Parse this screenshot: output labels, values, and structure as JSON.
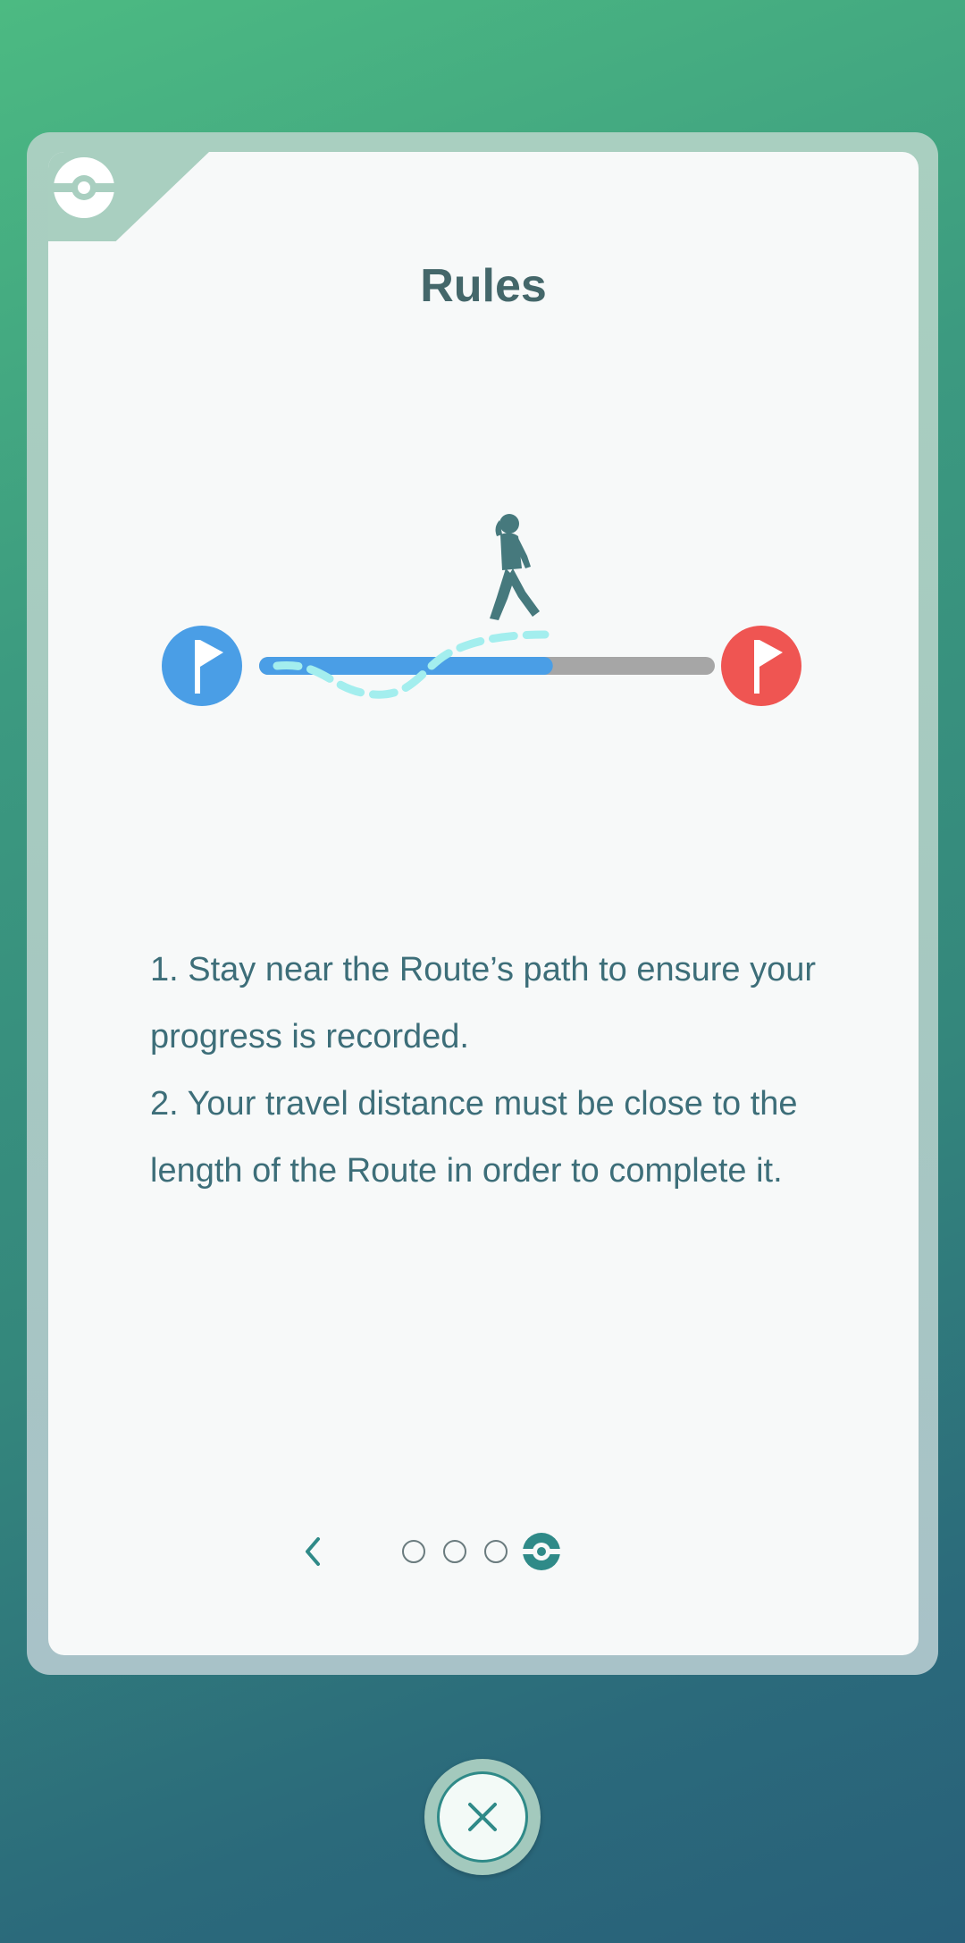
{
  "dialog": {
    "title": "Rules",
    "rules": [
      "1. Stay near the Route’s path to ensure your progress is recorded.",
      "2. Your travel distance must be close to the length of the Route in order to complete it."
    ]
  },
  "illustration": {
    "icons": [
      "start-flag-icon",
      "walking-person-icon",
      "end-flag-icon"
    ],
    "route_progress": 0.63,
    "colors": {
      "start": "#4a9ee6",
      "end": "#ef5552",
      "progress": "#4a9ee6",
      "track": "#a6a6a6",
      "path": "#a3eeee"
    }
  },
  "pager": {
    "pages_total": 4,
    "current_page": 4
  },
  "colors": {
    "accent": "#2f8a88",
    "title": "#44676a",
    "text": "#3d6e79"
  }
}
